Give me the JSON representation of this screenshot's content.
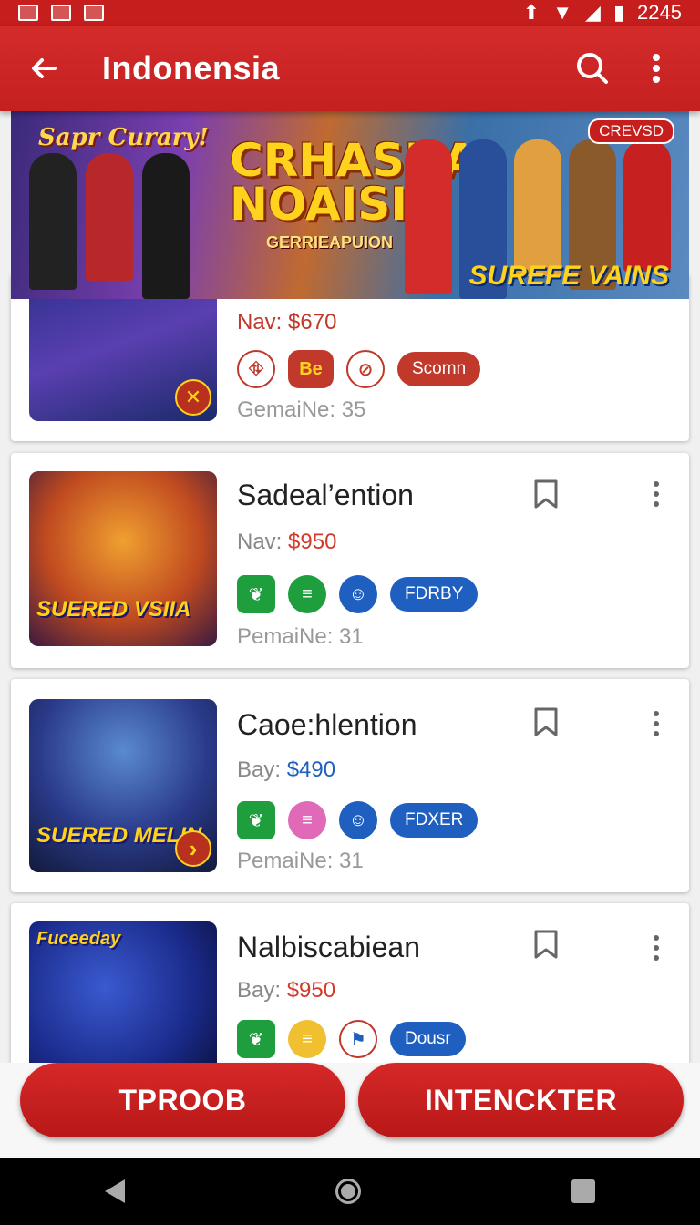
{
  "status_bar": {
    "time": "2245"
  },
  "app_bar": {
    "title": "Indonensia"
  },
  "banner": {
    "tagline": "Sapr Curary!",
    "title": "CRHASHA NOAISIA",
    "subtitle": "GERRIEAPUION",
    "badge": "CREVSD",
    "corner_label": "SUREFE VAINS"
  },
  "cards": [
    {
      "title": "",
      "price_label": "Nav:",
      "price_value": "$670",
      "price_color": "#c0392b",
      "tags": [
        {
          "kind": "round-outline",
          "text": "⛗",
          "color": "#c0392b"
        },
        {
          "kind": "square",
          "text": "Be",
          "color": "#c0392b",
          "text_color": "#ffd21e"
        },
        {
          "kind": "round-outline",
          "text": "⊘",
          "color": "#c0392b"
        },
        {
          "kind": "pill",
          "text": "Scomn",
          "color": "#c0392b"
        }
      ],
      "players": "GemaiNe: 35"
    },
    {
      "title": "Sadeal’ention",
      "price_label": "Nav:",
      "price_value": "$950",
      "price_color": "#d23a2a",
      "thumb_label": "SUERED VSIIA",
      "tags": [
        {
          "kind": "square",
          "text": "❦",
          "color": "#1e9e3c"
        },
        {
          "kind": "round",
          "text": "≡",
          "color": "#1e9e3c"
        },
        {
          "kind": "round",
          "text": "☺",
          "color": "#1f5fc0"
        },
        {
          "kind": "pill",
          "text": "FDRBY",
          "color": "#1f5fc0"
        }
      ],
      "players": "PemaiNe: 31"
    },
    {
      "title": "Caoe:hlention",
      "price_label": "Bay:",
      "price_value": "$490",
      "price_color": "#1f5fc0",
      "thumb_label": "SUERED MELIN",
      "tags": [
        {
          "kind": "square",
          "text": "❦",
          "color": "#1e9e3c"
        },
        {
          "kind": "round",
          "text": "≡",
          "color": "#e06ab8"
        },
        {
          "kind": "round",
          "text": "☺",
          "color": "#1f5fc0"
        },
        {
          "kind": "pill",
          "text": "FDXER",
          "color": "#1f5fc0"
        }
      ],
      "players": "PemaiNe: 31"
    },
    {
      "title": "Nalbiscabiean",
      "price_label": "Bay:",
      "price_value": "$950",
      "price_color": "#d23a2a",
      "thumb_label": "Fuceeday",
      "tags": [
        {
          "kind": "square",
          "text": "❦",
          "color": "#1e9e3c"
        },
        {
          "kind": "round",
          "text": "≡",
          "color": "#f0c030"
        },
        {
          "kind": "round-outline",
          "text": "⚑",
          "color": "#c0392b"
        },
        {
          "kind": "pill",
          "text": "Dousr",
          "color": "#1f5fc0"
        }
      ],
      "players": ""
    }
  ],
  "actions": {
    "left": "TPROOB",
    "right": "INTENCKTER"
  }
}
